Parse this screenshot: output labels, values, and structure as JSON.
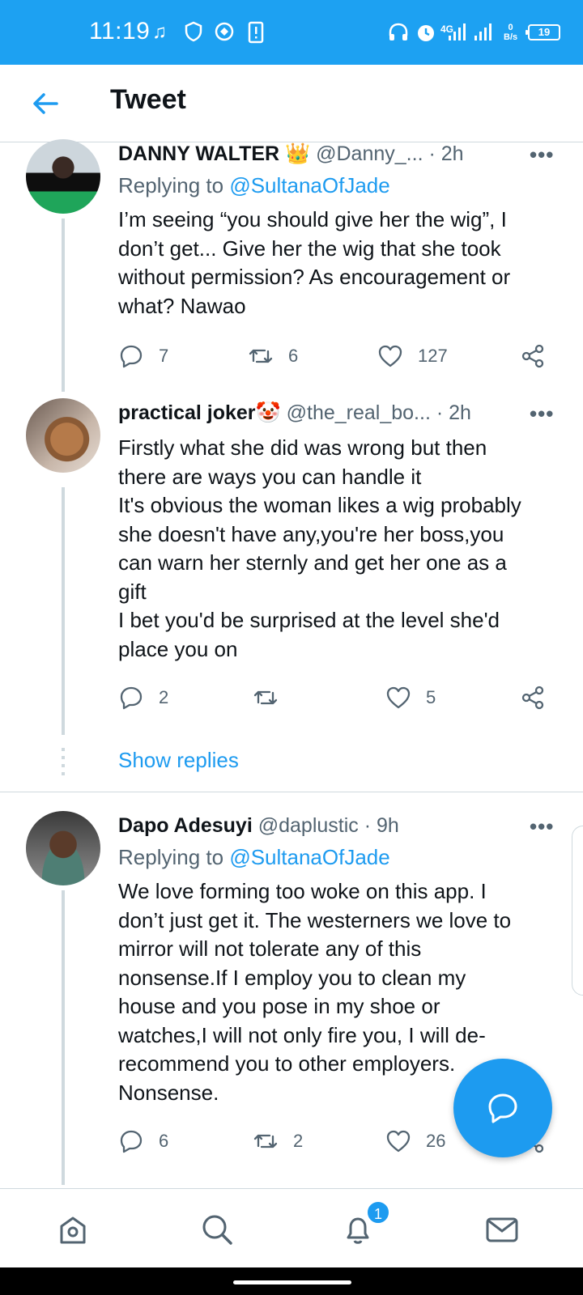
{
  "status_bar": {
    "time": "11:19",
    "network_label": "4G",
    "net_speed_top": "0",
    "net_speed_bottom": "B/s",
    "battery": "19"
  },
  "header": {
    "title": "Tweet"
  },
  "tweets": [
    {
      "name": "DANNY WALTER",
      "emoji": "👑",
      "handle": "@Danny_...",
      "time": "· 2h",
      "replying_prefix": "Replying to ",
      "replying_to": "@SultanaOfJade",
      "text": "I’m seeing “you should give her the wig”, I\ndon’t get... Give her the wig that she took\nwithout permission? As encouragement or\nwhat? Nawao",
      "replies": "7",
      "retweets": "6",
      "likes": "127"
    },
    {
      "name": "practical joker",
      "emoji": "🤡",
      "handle": "@the_real_bo...",
      "time": "· 2h",
      "text": "Firstly what she did was wrong but then\nthere are ways you can handle it\nIt's obvious the woman likes a wig probably\nshe doesn't have any,you're her boss,you\ncan warn her sternly and get her one as a\ngift\nI bet you'd be surprised at the level she'd\nplace you on",
      "replies": "2",
      "retweets": "",
      "likes": "5"
    },
    {
      "name": "Dapo Adesuyi",
      "handle": "@daplustic",
      "time": "· 9h",
      "replying_prefix": "Replying to ",
      "replying_to": "@SultanaOfJade",
      "text": "We love forming too woke on this app. I\ndon’t just get it. The westerners we love to\nmirror will not tolerate any of this\nnonsense.If I employ you to clean my\nhouse and you pose in my shoe or\nwatches,I will not only fire you, I will de-\nrecommend you to other employers.\nNonsense.",
      "replies": "6",
      "retweets": "2",
      "likes": "26"
    }
  ],
  "show_replies": "Show replies",
  "more_label": "•••",
  "bottom_nav": {
    "notifications_badge": "1",
    "items": [
      "home-icon",
      "search-icon",
      "bell-icon",
      "mail-icon"
    ]
  },
  "colors": {
    "accent": "#1d9bf0",
    "status_bar": "#1da1f2",
    "secondary_text": "#536471"
  }
}
